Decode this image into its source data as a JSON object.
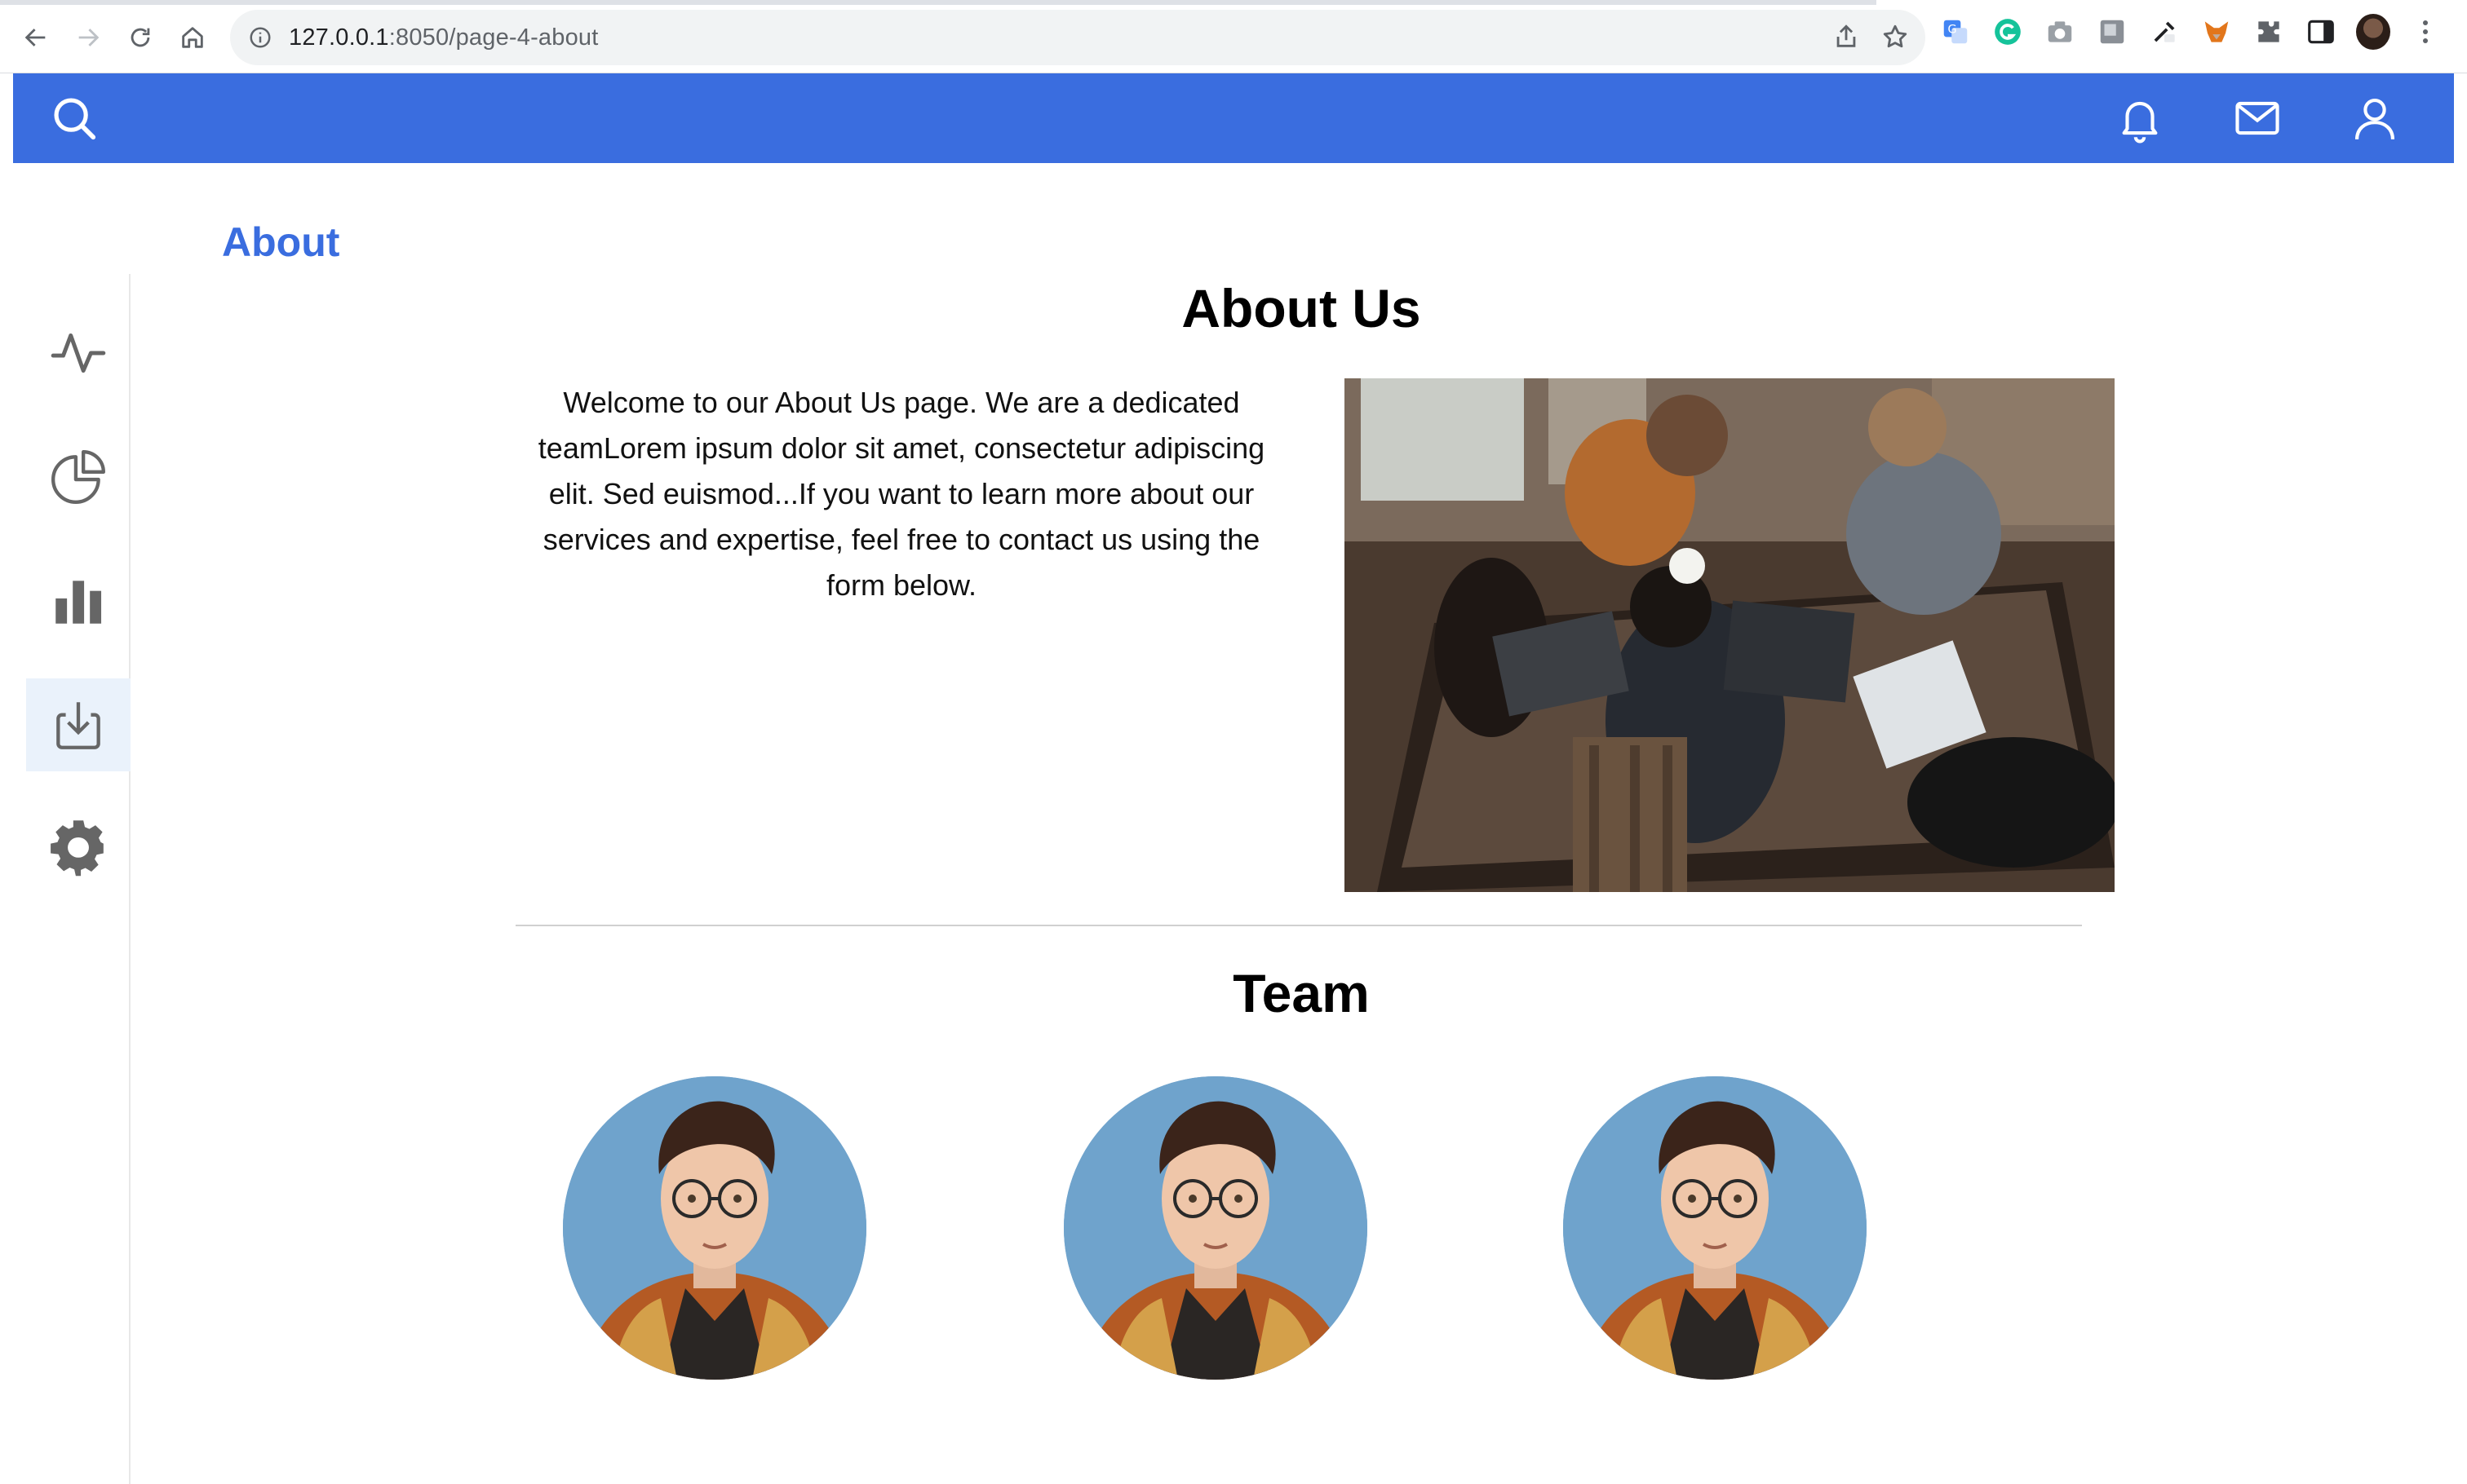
{
  "browser": {
    "url_host": "127.0.0.1",
    "url_path": ":8050/page-4-about"
  },
  "header": {
    "accent_color": "#3a6ddf",
    "left_icons": [
      "search-icon"
    ],
    "right_icons": [
      "bell-icon",
      "mail-icon",
      "user-icon"
    ]
  },
  "sidebar": {
    "items": [
      {
        "icon": "activity-icon"
      },
      {
        "icon": "pie-chart-icon"
      },
      {
        "icon": "bar-chart-icon"
      },
      {
        "icon": "download-icon",
        "active": true
      },
      {
        "icon": "gear-icon"
      }
    ]
  },
  "main": {
    "page_title": "About",
    "heading": "About Us",
    "intro_text": "Welcome to our About Us page. We are a dedicated teamLorem ipsum dolor sit amet, consectetur adipiscing elit. Sed euismod...If you want to learn more about our services and expertise, feel free to contact us using the form below.",
    "hero_image": "team-working-photo",
    "team_heading": "Team",
    "team_members": [
      {
        "avatar": "avatar-illustration"
      },
      {
        "avatar": "avatar-illustration"
      },
      {
        "avatar": "avatar-illustration"
      }
    ]
  }
}
